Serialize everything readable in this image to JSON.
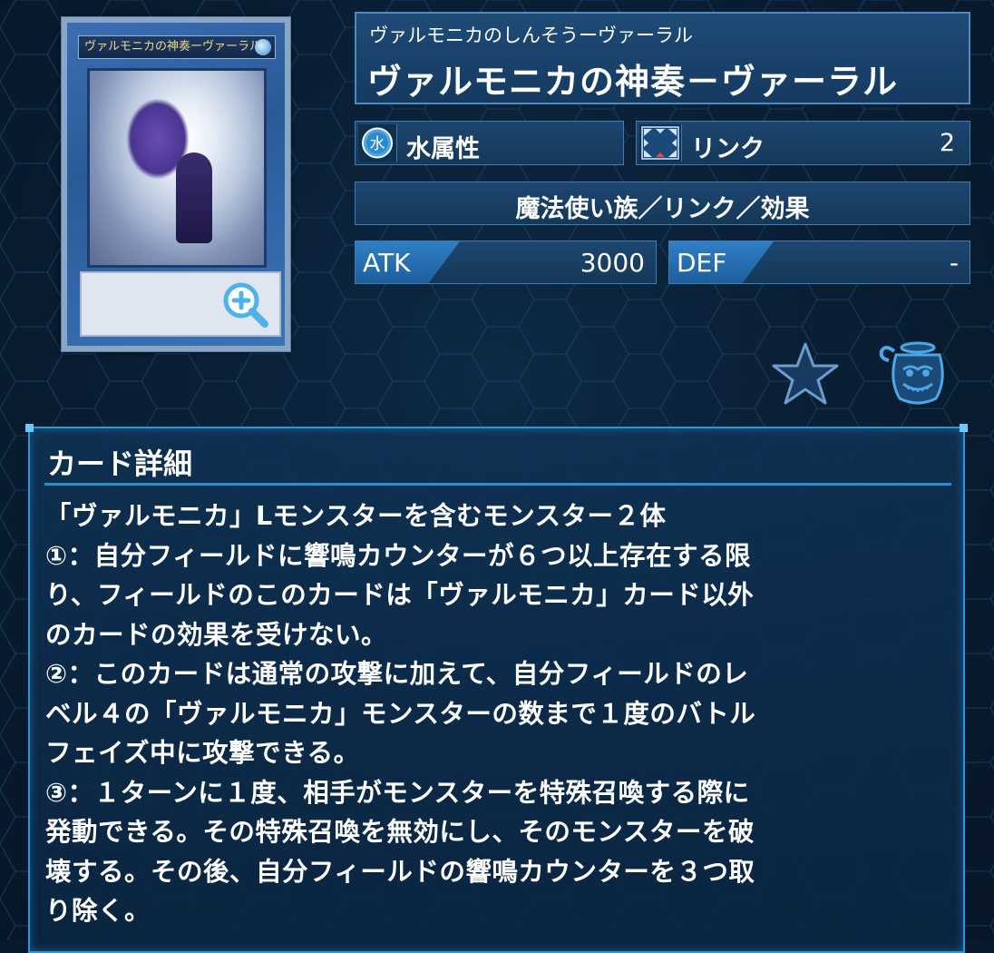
{
  "card": {
    "art_name": "ヴァルモニカの神奏ーヴァーラル",
    "name_ruby": "ヴァルモニカのしんそうーヴァーラル",
    "name": "ヴァルモニカの神奏－ヴァーラル",
    "attribute_icon": "water-attribute-icon",
    "attribute": "水属性",
    "link_icon": "link-arrows-icon",
    "link_label": "リンク",
    "link_value": "2",
    "type_line": "魔法使い族／リンク／効果",
    "atk_label": "ATK",
    "atk_value": "3000",
    "def_label": "DEF",
    "def_value": "-"
  },
  "actions": {
    "zoom_icon": "zoom-in-icon",
    "favorite_icon": "star-icon",
    "pot_icon": "pot-of-greed-icon"
  },
  "detail": {
    "title": "カード詳細",
    "text": "「ヴァルモニカ」Lモンスターを含むモンスター２体\n①：自分フィールドに響鳴カウンターが６つ以上存在する限\nり、フィールドのこのカードは「ヴァルモニカ」カード以外\nのカードの効果を受けない。\n②：このカードは通常の攻撃に加えて、自分フィールドのレ\nベル４の「ヴァルモニカ」モンスターの数まで１度のバトル\nフェイズ中に攻撃できる。\n③：１ターンに１度、相手がモンスターを特殊召喚する際に\n発動できる。その特殊召喚を無効にし、そのモンスターを破\n壊する。その後、自分フィールドの響鳴カウンターを３つ取\nり除く。"
  },
  "colors": {
    "background": "#0a1f35",
    "panel_border": "#2d95d8",
    "stat_tag": "#2f7fc7"
  }
}
